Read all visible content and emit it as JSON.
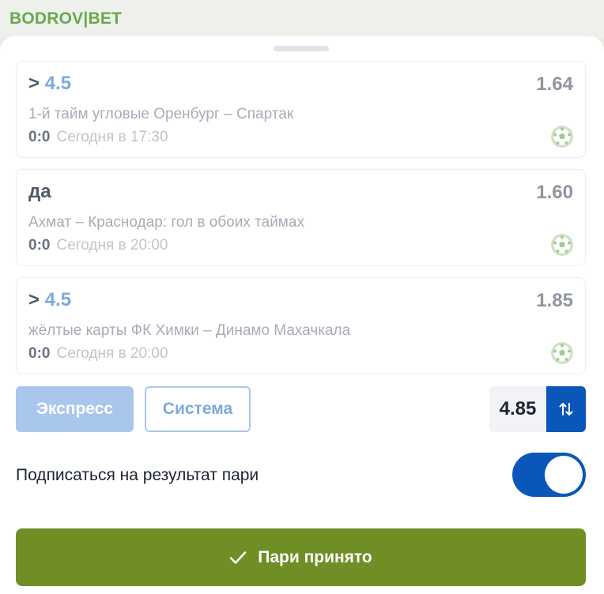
{
  "brand": {
    "name": "BODROV|BET",
    "color": "#6aa84f"
  },
  "coupon": {
    "bets": [
      {
        "outcome_prefix": ">",
        "outcome_value": "4.5",
        "odds": "1.64",
        "event": "1-й тайм угловые Оренбург – Спартак",
        "score": "0:0",
        "time": "Сегодня в 17:30",
        "icon": "soccer-ball-icon"
      },
      {
        "outcome_prefix": "да",
        "outcome_value": "",
        "odds": "1.60",
        "event": "Ахмат – Краснодар: гол в обоих таймах",
        "score": "0:0",
        "time": "Сегодня в 20:00",
        "icon": "soccer-ball-icon"
      },
      {
        "outcome_prefix": ">",
        "outcome_value": "4.5",
        "odds": "1.85",
        "event": "жёлтые карты ФК Химки – Динамо Махачкала",
        "score": "0:0",
        "time": "Сегодня в 20:00",
        "icon": "soccer-ball-icon"
      }
    ],
    "modes": {
      "express": "Экспресс",
      "system": "Система",
      "selected": "express"
    },
    "total_odds": "4.85",
    "swap_icon": "swap-arrows-icon",
    "subscribe": {
      "label": "Подписаться на результат пари",
      "enabled": true
    },
    "confirm": {
      "label": "Пари принято",
      "icon": "checkmark-icon"
    }
  },
  "colors": {
    "primary": "#0b56b9",
    "accent_light": "#a9c7ec",
    "success": "#6f8e26"
  }
}
